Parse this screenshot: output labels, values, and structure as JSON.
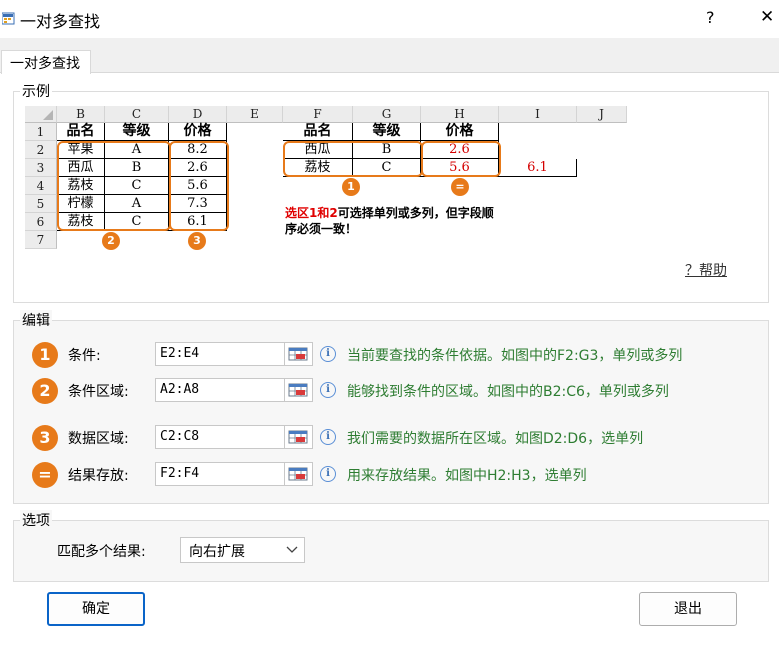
{
  "window": {
    "title": "一对多查找",
    "help_glyph": "?",
    "close_glyph": "✕"
  },
  "tab": {
    "label": "一对多查找"
  },
  "example": {
    "group_label": "示例",
    "columns": [
      "B",
      "C",
      "D",
      "E",
      "F",
      "G",
      "H",
      "I",
      "J"
    ],
    "rows": [
      "1",
      "2",
      "3",
      "4",
      "5",
      "6",
      "7"
    ],
    "left_table": {
      "header": [
        "品名",
        "等级",
        "价格"
      ],
      "data": [
        [
          "苹果",
          "A",
          "8.2"
        ],
        [
          "西瓜",
          "B",
          "2.6"
        ],
        [
          "荔枝",
          "C",
          "5.6"
        ],
        [
          "柠檬",
          "A",
          "7.3"
        ],
        [
          "荔枝",
          "C",
          "6.1"
        ]
      ]
    },
    "right_table": {
      "header": [
        "品名",
        "等级",
        "价格"
      ],
      "data": [
        [
          "西瓜",
          "B",
          "2.6",
          ""
        ],
        [
          "荔枝",
          "C",
          "5.6",
          "6.1"
        ]
      ]
    },
    "badges": [
      "1",
      "2",
      "3",
      "="
    ],
    "note_red": "选区1和2",
    "note_rest": "可选择单列或多列，但字段顺序必须一致！",
    "help_link": "？帮助"
  },
  "edit": {
    "group_label": "编辑",
    "rows": [
      {
        "badge": "1",
        "label": "条件:",
        "value": "E2:E4",
        "desc": "当前要查找的条件依据。如图中的F2:G3，单列或多列"
      },
      {
        "badge": "2",
        "label": "条件区域:",
        "value": "A2:A8",
        "desc": "能够找到条件的区域。如图中的B2:C6，单列或多列"
      },
      {
        "badge": "3",
        "label": "数据区域:",
        "value": "C2:C8",
        "desc": "我们需要的数据所在区域。如图D2:D6，选单列"
      },
      {
        "badge": "=",
        "label": "结果存放:",
        "value": "F2:F4",
        "desc": "用来存放结果。如图中H2:H3，选单列"
      }
    ]
  },
  "options": {
    "group_label": "选项",
    "match_label": "匹配多个结果:",
    "match_value": "向右扩展"
  },
  "buttons": {
    "ok": "确定",
    "cancel": "退出"
  },
  "colors": {
    "accent": "#e77a1a",
    "desc_text": "#2e7d32",
    "red_value": "#d40000",
    "primary_border": "#0a64c8"
  }
}
